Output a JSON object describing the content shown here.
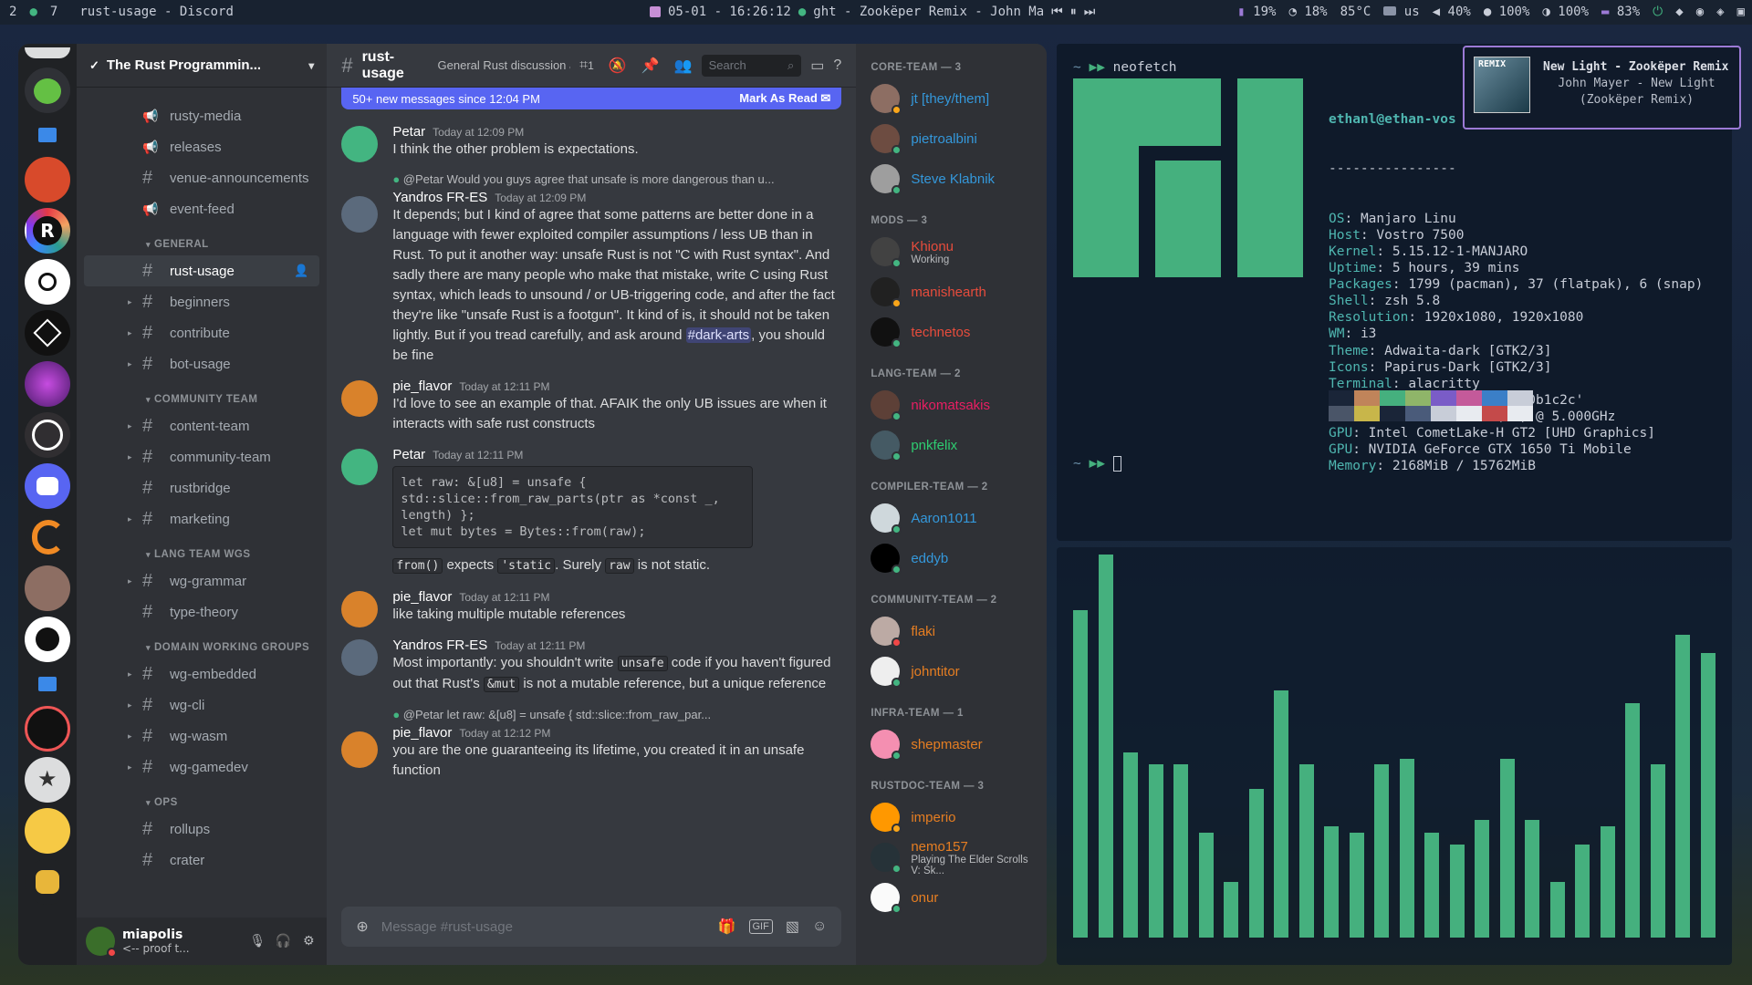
{
  "topbar": {
    "workspaces": [
      "2",
      "7"
    ],
    "window_title": "rust-usage - Discord",
    "datetime": "05-01 - 16:26:12",
    "now_playing": "ght - Zookëper Remix - John Ma",
    "stats": [
      "19%",
      "18%",
      "85°C",
      "us",
      "40%",
      "100%",
      "100%",
      "83%"
    ]
  },
  "discord": {
    "server_name": "The Rust Programmin...",
    "channel": "rust-usage",
    "topic": "General Rust discussion and support",
    "thread_count": "1",
    "search_placeholder": "Search",
    "banner_text": "50+ new messages since 12:04 PM",
    "banner_action": "Mark As Read",
    "composer_placeholder": "Message #rust-usage",
    "user": {
      "name": "miapolis",
      "status": "<-- proof t..."
    },
    "channels": [
      {
        "type": "text-announce",
        "name": "rusty-media"
      },
      {
        "type": "text-announce",
        "name": "releases"
      },
      {
        "type": "text",
        "name": "venue-announcements"
      },
      {
        "type": "text-announce",
        "name": "event-feed"
      },
      {
        "type": "category",
        "name": "GENERAL"
      },
      {
        "type": "text",
        "name": "rust-usage",
        "active": true
      },
      {
        "type": "text",
        "name": "beginners",
        "arrow": true
      },
      {
        "type": "text",
        "name": "contribute",
        "arrow": true
      },
      {
        "type": "text",
        "name": "bot-usage",
        "arrow": true
      },
      {
        "type": "category",
        "name": "COMMUNITY TEAM"
      },
      {
        "type": "text",
        "name": "content-team",
        "arrow": true
      },
      {
        "type": "text",
        "name": "community-team",
        "arrow": true
      },
      {
        "type": "text",
        "name": "rustbridge"
      },
      {
        "type": "text",
        "name": "marketing",
        "arrow": true
      },
      {
        "type": "category",
        "name": "LANG TEAM WGS"
      },
      {
        "type": "text",
        "name": "wg-grammar",
        "arrow": true
      },
      {
        "type": "text",
        "name": "type-theory"
      },
      {
        "type": "category",
        "name": "DOMAIN WORKING GROUPS"
      },
      {
        "type": "text",
        "name": "wg-embedded",
        "arrow": true
      },
      {
        "type": "text",
        "name": "wg-cli",
        "arrow": true
      },
      {
        "type": "text",
        "name": "wg-wasm",
        "arrow": true
      },
      {
        "type": "text",
        "name": "wg-gamedev",
        "arrow": true
      },
      {
        "type": "category",
        "name": "OPS"
      },
      {
        "type": "text",
        "name": "rollups"
      },
      {
        "type": "text",
        "name": "crater"
      }
    ],
    "messages": [
      {
        "author": "Petar",
        "time": "Today at 12:09 PM",
        "color": "#ffffff",
        "avatar": "#43b581",
        "text": "I think the other problem is expectations."
      },
      {
        "author": "Yandros FR-ES",
        "time": "Today at 12:09 PM",
        "color": "#ffffff",
        "avatar": "#5b6a7c",
        "reply": "@Petar Would you guys agree that unsafe is more dangerous than u...",
        "text": "It depends; but I kind of agree that some patterns are better done in a language with fewer exploited compiler assumptions / less UB than in Rust. To put it another way: unsafe Rust is not \"C with Rust syntax\". And sadly there are many people who make that mistake, write C using Rust syntax, which leads to unsound / or UB-triggering code, and after the fact they're like \"unsafe Rust is a footgun\". It kind of is, it should not be taken lightly. But if you tread carefully, and ask around #dark-arts, you should be fine"
      },
      {
        "author": "pie_flavor",
        "time": "Today at 12:11 PM",
        "color": "#ffffff",
        "avatar": "#d9822b",
        "text": "I'd love to see an example of that. AFAIK the only UB issues are when it interacts with safe rust constructs"
      },
      {
        "author": "Petar",
        "time": "Today at 12:11 PM",
        "color": "#ffffff",
        "avatar": "#43b581",
        "code": "let raw: &[u8] = unsafe {\nstd::slice::from_raw_parts(ptr as *const _,\nlength) };\nlet mut bytes = Bytes::from(raw);",
        "text": "from() expects 'static. Surely raw is not static."
      },
      {
        "author": "pie_flavor",
        "time": "Today at 12:11 PM",
        "color": "#ffffff",
        "avatar": "#d9822b",
        "text": "like taking multiple mutable references"
      },
      {
        "author": "Yandros FR-ES",
        "time": "Today at 12:11 PM",
        "color": "#ffffff",
        "avatar": "#5b6a7c",
        "text": "Most importantly: you shouldn't write unsafe code if you haven't figured out that Rust's &mut is not a mutable reference, but a unique reference"
      },
      {
        "author": "pie_flavor",
        "time": "Today at 12:12 PM",
        "color": "#ffffff",
        "avatar": "#d9822b",
        "reply": "@Petar let raw: &[u8] = unsafe { std::slice::from_raw_par...",
        "text": "you are the one guaranteeing its lifetime, you created it in an unsafe function"
      }
    ],
    "member_groups": [
      {
        "title": "CORE-TEAM — 3",
        "members": [
          {
            "name": "jt [they/them]",
            "color": "#3498db",
            "status": "#faa61a",
            "avatar": "#8d6e63"
          },
          {
            "name": "pietroalbini",
            "color": "#3498db",
            "status": "#43b581",
            "avatar": "#6d4c41"
          },
          {
            "name": "Steve Klabnik",
            "color": "#3498db",
            "status": "#43b581",
            "avatar": "#9e9e9e"
          }
        ]
      },
      {
        "title": "MODS — 3",
        "members": [
          {
            "name": "Khionu",
            "sub": "Working",
            "color": "#e74c3c",
            "status": "#43b581",
            "avatar": "#424242"
          },
          {
            "name": "manishearth",
            "color": "#e74c3c",
            "status": "#faa61a",
            "avatar": "#212121"
          },
          {
            "name": "technetos",
            "color": "#e74c3c",
            "status": "#43b581",
            "avatar": "#111111"
          }
        ]
      },
      {
        "title": "LANG-TEAM — 2",
        "members": [
          {
            "name": "nikomatsakis",
            "color": "#e91e63",
            "status": "#43b581",
            "avatar": "#5d4037"
          },
          {
            "name": "pnkfelix",
            "color": "#2ecc71",
            "status": "#43b581",
            "avatar": "#455a64"
          }
        ]
      },
      {
        "title": "COMPILER-TEAM — 2",
        "members": [
          {
            "name": "Aaron1011",
            "color": "#3498db",
            "status": "#43b581",
            "avatar": "#cfd8dc"
          },
          {
            "name": "eddyb",
            "color": "#3498db",
            "status": "#43b581",
            "avatar": "#000000"
          }
        ]
      },
      {
        "title": "COMMUNITY-TEAM — 2",
        "members": [
          {
            "name": "flaki",
            "color": "#e67e22",
            "status": "#f04747",
            "avatar": "#bcaaa4"
          },
          {
            "name": "johntitor",
            "color": "#e67e22",
            "status": "#43b581",
            "avatar": "#eeeeee"
          }
        ]
      },
      {
        "title": "INFRA-TEAM — 1",
        "members": [
          {
            "name": "shepmaster",
            "color": "#e67e22",
            "status": "#43b581",
            "avatar": "#f48fb1"
          }
        ]
      },
      {
        "title": "RUSTDOC-TEAM — 3",
        "members": [
          {
            "name": "imperio",
            "color": "#e67e22",
            "status": "#faa61a",
            "avatar": "#ff9800"
          },
          {
            "name": "nemo157",
            "sub": "Playing The Elder Scrolls V: Sk...",
            "color": "#e67e22",
            "status": "#43b581",
            "avatar": "#263238"
          },
          {
            "name": "onur",
            "color": "#e67e22",
            "status": "#43b581",
            "avatar": "#fafafa"
          }
        ]
      }
    ]
  },
  "terminal": {
    "command": "neofetch",
    "user_host": "ethanl@ethan-vos",
    "separator": "----------------",
    "info": [
      {
        "key": "OS",
        "value": "Manjaro Linu"
      },
      {
        "key": "Host",
        "value": "Vostro 7500"
      },
      {
        "key": "Kernel",
        "value": "5.15.12-1-MANJARO"
      },
      {
        "key": "Uptime",
        "value": "5 hours, 39 mins"
      },
      {
        "key": "Packages",
        "value": "1799 (pacman), 37 (flatpak), 6 (snap)"
      },
      {
        "key": "Shell",
        "value": "zsh 5.8"
      },
      {
        "key": "Resolution",
        "value": "1920x1080, 1920x1080"
      },
      {
        "key": "WM",
        "value": "i3"
      },
      {
        "key": "Theme",
        "value": "Adwaita-dark [GTK2/3]"
      },
      {
        "key": "Icons",
        "value": "Papirus-Dark [GTK2/3]"
      },
      {
        "key": "Terminal",
        "value": "alacritty"
      },
      {
        "key": "Terminal Font",
        "value": "black: '0x0b1c2c'"
      },
      {
        "key": "CPU",
        "value": "Intel i7-10750H (12) @ 5.000GHz"
      },
      {
        "key": "GPU",
        "value": "Intel CometLake-H GT2 [UHD Graphics]"
      },
      {
        "key": "GPU",
        "value": "NVIDIA GeForce GTX 1650 Ti Mobile"
      },
      {
        "key": "Memory",
        "value": "2168MiB / 15762MiB"
      }
    ],
    "palette_top": [
      "#1a2538",
      "#c0845a",
      "#45b07e",
      "#8fb569",
      "#7a5cc7",
      "#c45a9a",
      "#3b7fc7",
      "#c8cdd8"
    ],
    "palette_bottom": [
      "#4a5568",
      "#c8b64a",
      "#1a2538",
      "#4a5b7a",
      "#c8cdd8",
      "#e8ebf0",
      "#c44a4a",
      "#e8ebf0"
    ]
  },
  "visualizer": {
    "levels": [
      0.53,
      0.62,
      0.3,
      0.28,
      0.28,
      0.17,
      0.09,
      0.24,
      0.4,
      0.28,
      0.18,
      0.17,
      0.28,
      0.29,
      0.17,
      0.15,
      0.19,
      0.29,
      0.19,
      0.09,
      0.15,
      0.18,
      0.38,
      0.28,
      0.49,
      0.46
    ]
  },
  "notification": {
    "art_label": "REMIX",
    "title": "New Light - Zookëper Remix",
    "artist": "John Mayer - New Light",
    "album": "(Zookëper Remix)"
  },
  "colors": {
    "accent": "#5865f2",
    "online": "#43b581",
    "idle": "#faa61a",
    "dnd": "#f04747",
    "viz_bar": "#45b07e"
  }
}
